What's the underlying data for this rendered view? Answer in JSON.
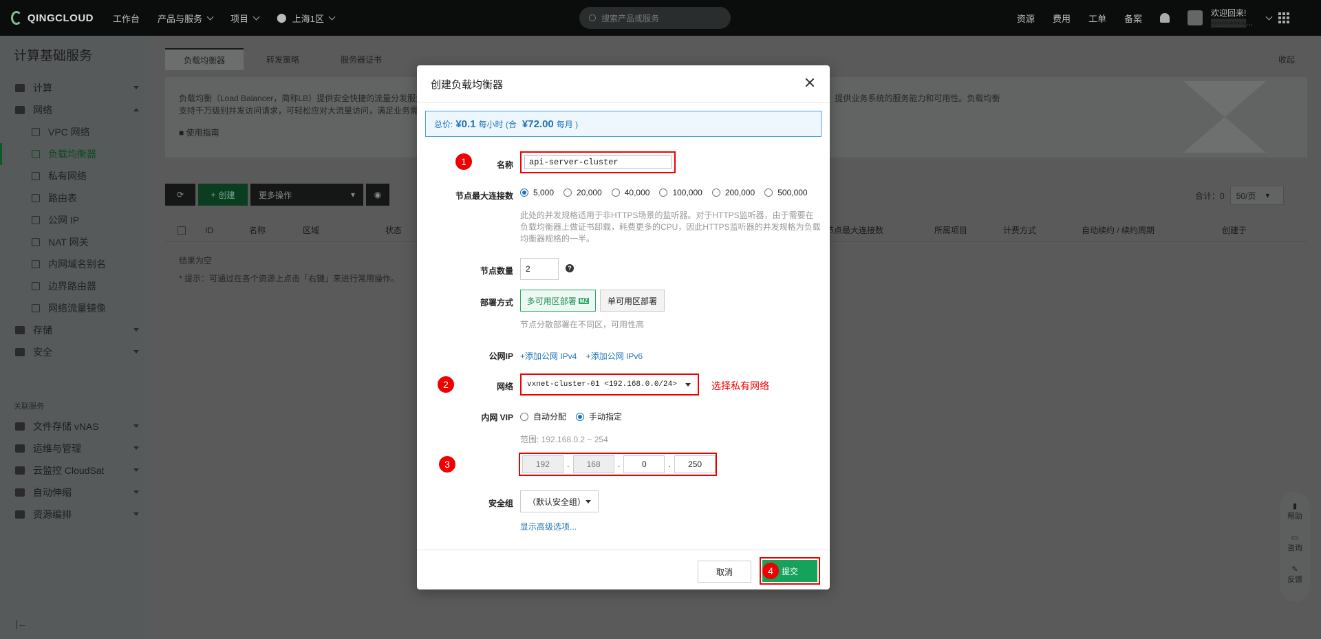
{
  "topbar": {
    "logo": "QINGCLOUD",
    "nav": [
      "工作台",
      "产品与服务",
      "项目",
      "上海1区"
    ],
    "search_placeholder": "搜索产品或服务",
    "links": [
      "资源",
      "费用",
      "工单",
      "备案"
    ],
    "welcome": "欢迎回来!"
  },
  "sidebar": {
    "title": "计算基础服务",
    "groups": [
      {
        "label": "计算"
      },
      {
        "label": "网络"
      }
    ],
    "network_items": [
      "VPC 网络",
      "负载均衡器",
      "私有网络",
      "路由表",
      "公网 IP",
      "NAT 网关",
      "内网域名别名",
      "边界路由器",
      "网络流量镜像"
    ],
    "more_groups": [
      "存储",
      "安全"
    ],
    "related_title": "关联服务",
    "related": [
      "文件存储 vNAS",
      "运维与管理",
      "云监控 CloudSat",
      "自动伸缩",
      "资源编排"
    ]
  },
  "main": {
    "tabs": [
      "负载均衡器",
      "转发策略",
      "服务器证书"
    ],
    "collapse": "收起",
    "description": "负载均衡（Load Balancer，简称LB）提供安全快捷的流量分发服务，来自多个公网地址的访问流量经由 LB 可以自动分配到多台云服务器上，并支持自动检测并隔离故障云服务器，提供业务系统的服务能力和可用性。负载均衡支持千万级别并发访问请求，可轻松应对大流量访问，满足业务需求。",
    "guide": "使用指南",
    "toolbar": {
      "create": "创建",
      "more": "更多操作"
    },
    "columns": [
      "ID",
      "名称",
      "区域",
      "状态",
      "节点最大连接数",
      "所属项目",
      "计费方式",
      "自动续约 / 续约周期",
      "创建于"
    ],
    "empty": "结果为空",
    "hint": "* 提示：可通过在各个资源上点击「右键」来进行常用操作。",
    "total": "合计：0",
    "page_size": "50/页"
  },
  "float_help": [
    "帮助",
    "咨询",
    "反馈"
  ],
  "modal": {
    "title": "创建负载均衡器",
    "price": {
      "label": "总价:",
      "hourly": "¥0.1",
      "hourly_unit": "每小时 (合",
      "monthly": "¥72.00",
      "monthly_unit": "每月 )"
    },
    "name_label": "名称",
    "name_value": "api-server-cluster",
    "conn_label": "节点最大连接数",
    "conn_options": [
      "5,000",
      "20,000",
      "40,000",
      "100,000",
      "200,000",
      "500,000"
    ],
    "conn_note": "此处的并发规格适用于非HTTPS场景的监听器。对于HTTPS监听器，由于需要在负载均衡器上做证书卸载，耗费更多的CPU，因此HTTPS监听器的并发规格为负载均衡器规格的一半。",
    "nodes_label": "节点数量",
    "nodes_value": "2",
    "deploy_label": "部署方式",
    "deploy_multi": "多可用区部署",
    "deploy_mz": "MZ",
    "deploy_single": "单可用区部署",
    "deploy_note": "节点分散部署在不同区，可用性高",
    "ip_label": "公网IP",
    "ip_add4": "+添加公网 IPv4",
    "ip_add6": "+添加公网 IPv6",
    "net_label": "网络",
    "net_value": "vxnet-cluster-01 <192.168.0.0/24>",
    "net_annotation": "选择私有网络",
    "vip_label": "内网 VIP",
    "vip_auto": "自动分配",
    "vip_manual": "手动指定",
    "range": "范围: 192.168.0.2 ~ 254",
    "octets": [
      "192",
      "168",
      "0",
      "250"
    ],
    "sg_label": "安全组",
    "sg_value": "（默认安全组）",
    "advanced": "显示高级选项...",
    "cancel": "取消",
    "submit": "提交",
    "badges": [
      "1",
      "2",
      "3",
      "4"
    ]
  }
}
